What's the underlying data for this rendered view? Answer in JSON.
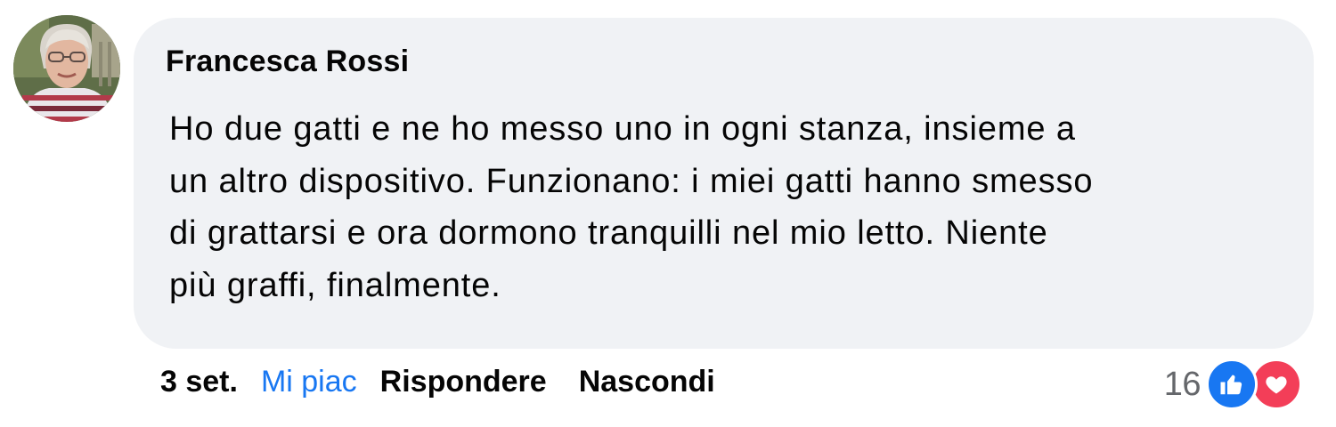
{
  "comment": {
    "author": "Francesca Rossi",
    "text": "Ho due gatti e ne ho messo uno in ogni stanza, insieme a un altro dispositivo. Funzionano: i miei gatti hanno smesso di grattarsi e ora dormono tranquilli nel mio letto. Niente più graffi, finalmente.",
    "text_lines": [
      "Ho due gatti e ne ho messo uno in ogni stanza, insieme a",
      "un altro dispositivo. Funzionano: i miei gatti hanno smesso",
      "di grattarsi e ora dormono tranquilli nel mio letto. Niente",
      "più graffi, finalmente."
    ],
    "avatar_icon": "user-avatar-photo",
    "bubble_color": "#f0f2f5"
  },
  "actions": {
    "timestamp": "3 set.",
    "like_label": "Mi piac",
    "reply_label": "Rispondere",
    "hide_label": "Nascondi",
    "like_color": "#1877f2"
  },
  "reactions": {
    "count": "16",
    "icons": [
      "like-reaction-icon",
      "love-reaction-icon"
    ],
    "like_color": "#1877f2",
    "love_color": "#f33e58"
  }
}
